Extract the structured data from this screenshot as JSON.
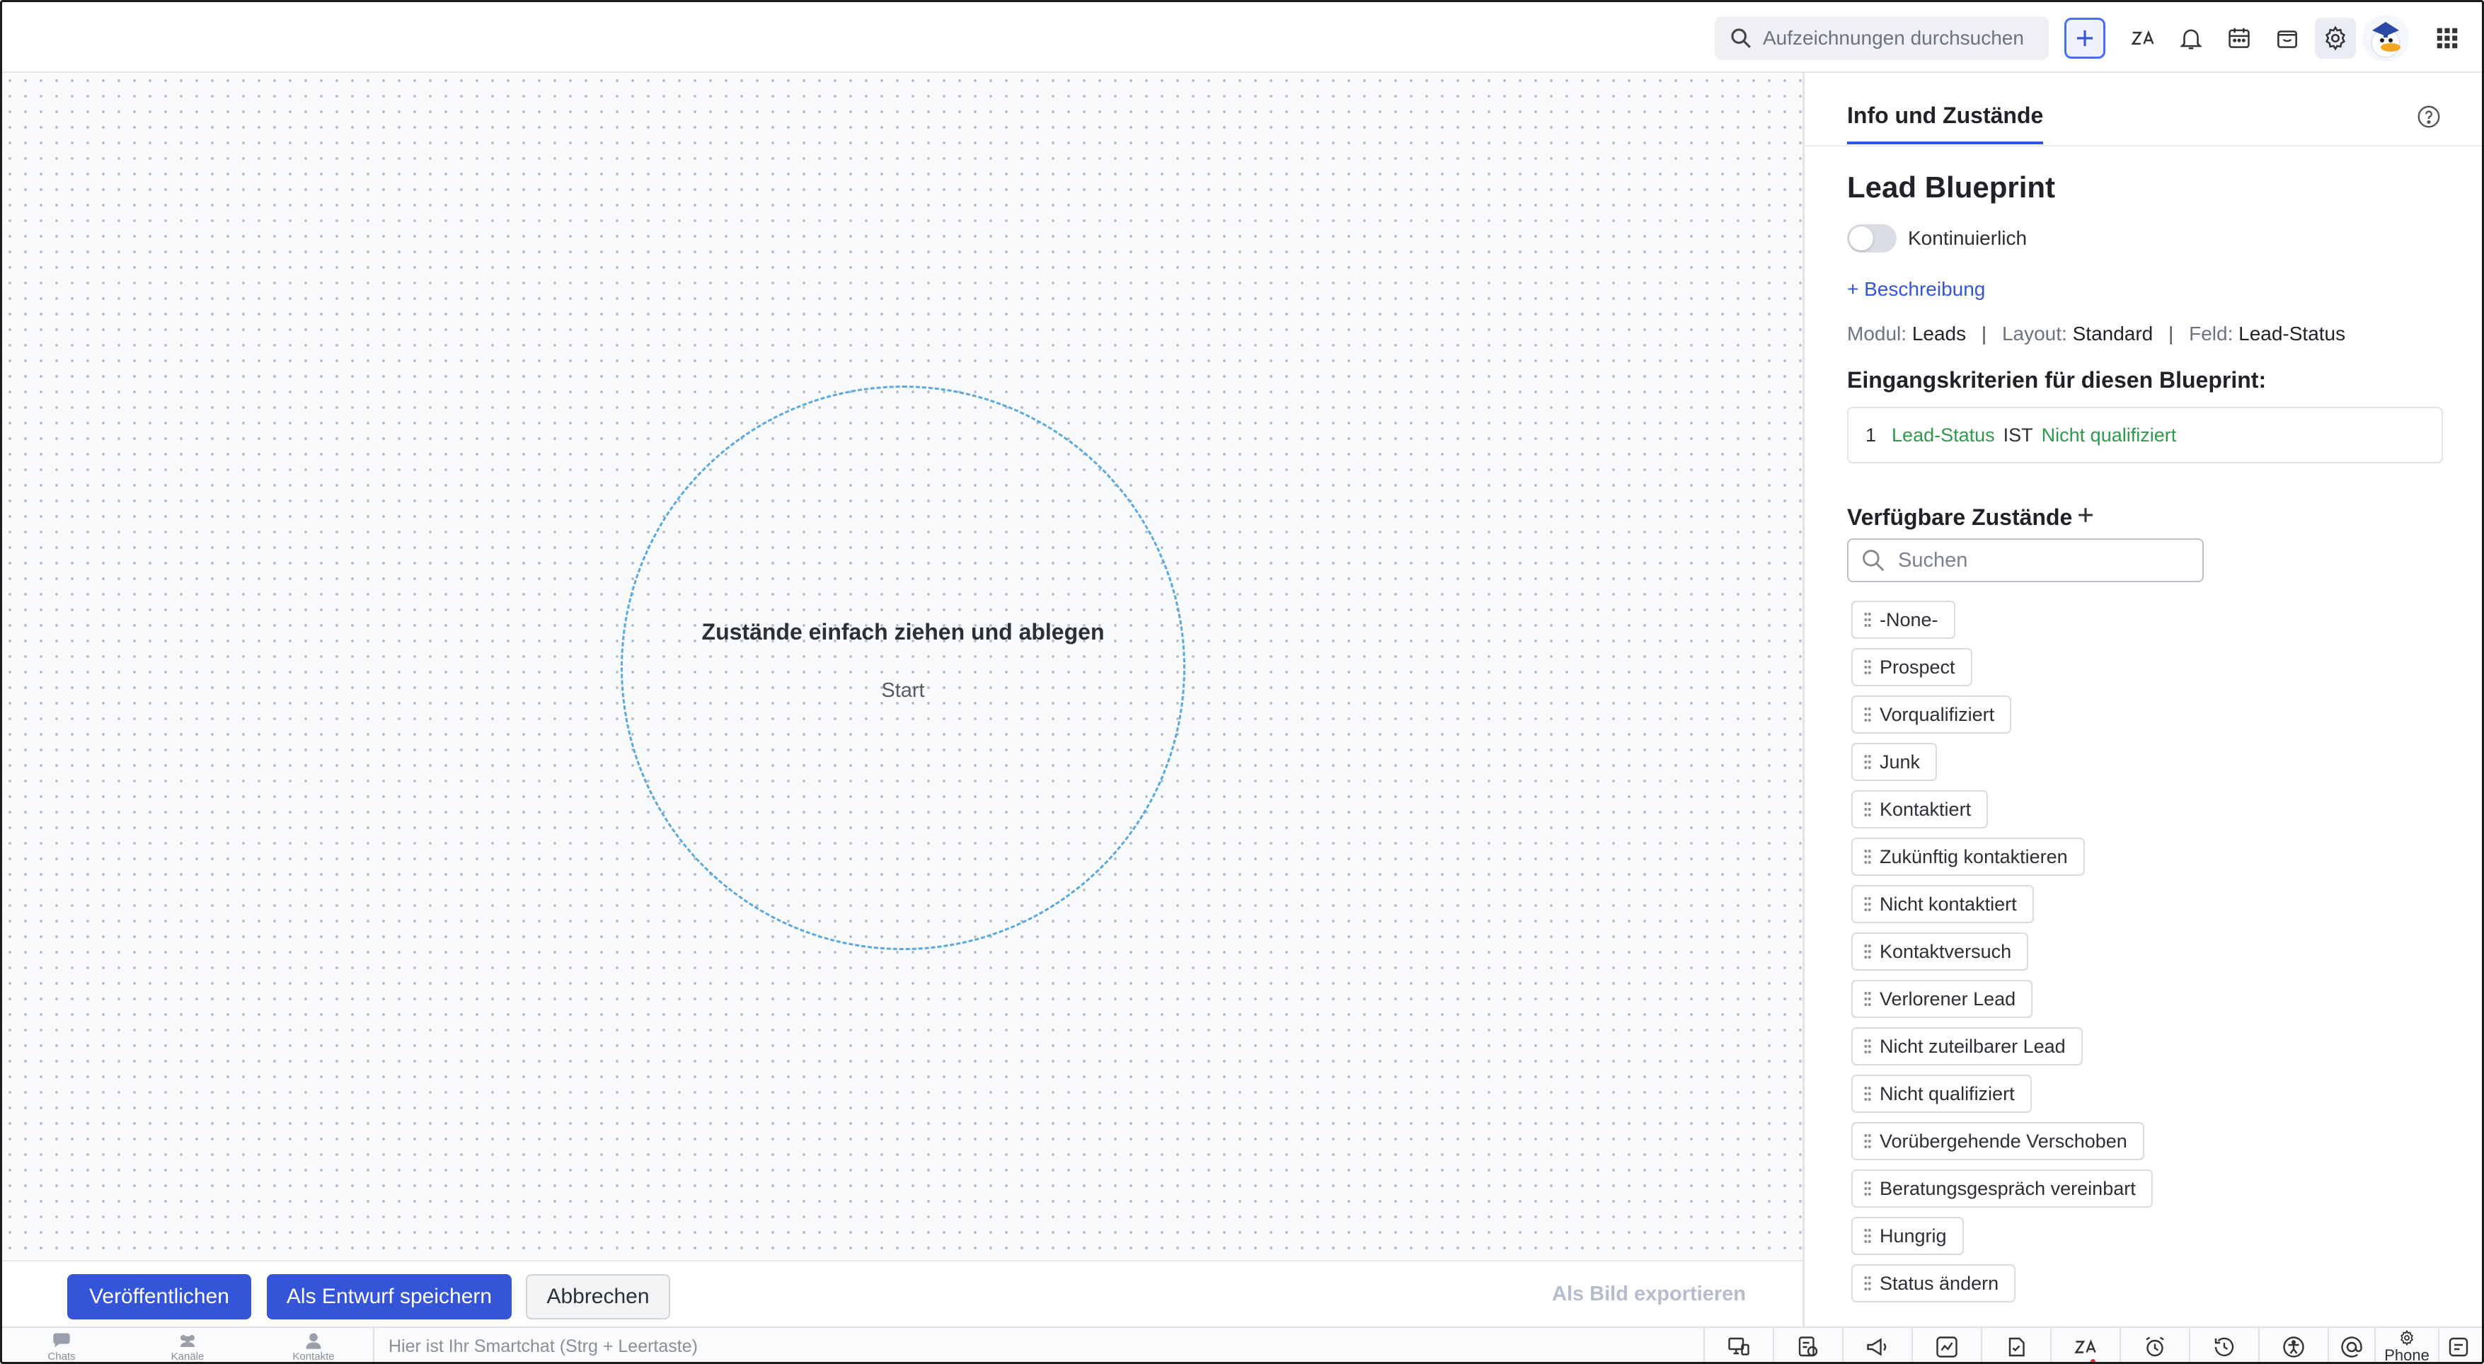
{
  "topbar": {
    "search_placeholder": "Aufzeichnungen durchsuchen",
    "icons": [
      "search-icon",
      "plus-icon",
      "zia-icon",
      "bell-icon",
      "calendar-icon",
      "marketplace-icon",
      "gear-icon",
      "avatar",
      "apps-grid-icon"
    ]
  },
  "canvas": {
    "drop_title": "Zustände einfach ziehen und ablegen",
    "drop_sub": "Start"
  },
  "actions": {
    "publish": "Veröffentlichen",
    "save_draft": "Als Entwurf speichern",
    "cancel": "Abbrechen",
    "export": "Als Bild exportieren"
  },
  "panel": {
    "tab": "Info und Zustände",
    "title": "Lead Blueprint",
    "toggle_label": "Kontinuierlich",
    "toggle_on": false,
    "add_description": "+ Beschreibung",
    "meta": {
      "module_label": "Modul:",
      "module_value": "Leads",
      "layout_label": "Layout:",
      "layout_value": "Standard",
      "field_label": "Feld:",
      "field_value": "Lead-Status",
      "separator": "|"
    },
    "criteria_title": "Eingangskriterien für diesen Blueprint:",
    "criteria": {
      "num": "1",
      "field": "Lead-Status",
      "operator": "IST",
      "value": "Nicht qualifiziert"
    },
    "states_title": "Verfügbare Zustände",
    "states_search_placeholder": "Suchen",
    "states": [
      "-None-",
      "Prospect",
      "Vorqualifiziert",
      "Junk",
      "Kontaktiert",
      "Zukünftig kontaktieren",
      "Nicht kontaktiert",
      "Kontaktversuch",
      "Verlorener Lead",
      "Nicht zuteilbarer Lead",
      "Nicht qualifiziert",
      "Vorübergehende Verschoben",
      "Beratungsgespräch vereinbart",
      "Hungrig",
      "Status ändern"
    ]
  },
  "statusbar": {
    "chats": "Chats",
    "channels": "Kanäle",
    "contacts": "Kontakte",
    "chat_placeholder": "Hier ist Ihr Smartchat (Strg + Leertaste)",
    "phone": "Phone"
  },
  "colors": {
    "accent": "#3555d8",
    "criteria_green": "#2d9a4b",
    "dashed_circle": "#5aa8dd"
  }
}
